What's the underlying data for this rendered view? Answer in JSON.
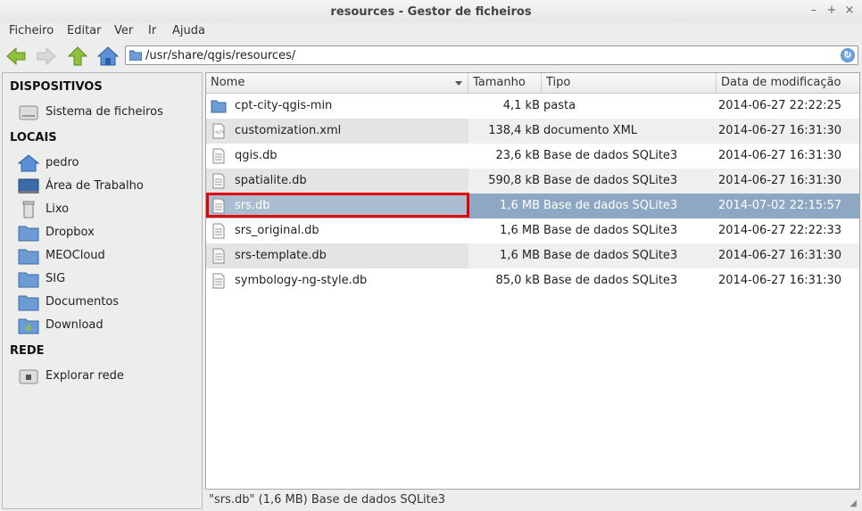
{
  "window": {
    "title": "resources - Gestor de ficheiros"
  },
  "menu": [
    "Ficheiro",
    "Editar",
    "Ver",
    "Ir",
    "Ajuda"
  ],
  "address": {
    "path": "/usr/share/qgis/resources/"
  },
  "sidebar": {
    "sections": [
      {
        "title": "DISPOSITIVOS",
        "items": [
          {
            "label": "Sistema de ficheiros",
            "icon": "drive-icon"
          }
        ]
      },
      {
        "title": "LOCAIS",
        "items": [
          {
            "label": "pedro",
            "icon": "home-icon"
          },
          {
            "label": "Área de Trabalho",
            "icon": "desktop-icon"
          },
          {
            "label": "Lixo",
            "icon": "trash-icon"
          },
          {
            "label": "Dropbox",
            "icon": "folder-icon"
          },
          {
            "label": "MEOCloud",
            "icon": "folder-icon"
          },
          {
            "label": "SIG",
            "icon": "folder-icon"
          },
          {
            "label": "Documentos",
            "icon": "folder-icon"
          },
          {
            "label": "Download",
            "icon": "download-folder-icon"
          }
        ]
      },
      {
        "title": "REDE",
        "items": [
          {
            "label": "Explorar rede",
            "icon": "network-icon"
          }
        ]
      }
    ]
  },
  "columns": {
    "name": "Nome",
    "size": "Tamanho",
    "type": "Tipo",
    "date": "Data de modificação"
  },
  "files": [
    {
      "name": "cpt-city-qgis-min",
      "size": "4,1 kB",
      "type": "pasta",
      "date": "2014-06-27 22:22:25",
      "icon": "folder-icon"
    },
    {
      "name": "customization.xml",
      "size": "138,4 kB",
      "type": "documento XML",
      "date": "2014-06-27 16:31:30",
      "icon": "xml-file-icon"
    },
    {
      "name": "qgis.db",
      "size": "23,6 kB",
      "type": "Base de dados SQLite3",
      "date": "2014-06-27 16:31:30",
      "icon": "document-icon"
    },
    {
      "name": "spatialite.db",
      "size": "590,8 kB",
      "type": "Base de dados SQLite3",
      "date": "2014-06-27 16:31:30",
      "icon": "document-icon"
    },
    {
      "name": "srs.db",
      "size": "1,6 MB",
      "type": "Base de dados SQLite3",
      "date": "2014-07-02 22:15:57",
      "icon": "document-icon",
      "selected": true
    },
    {
      "name": "srs_original.db",
      "size": "1,6 MB",
      "type": "Base de dados SQLite3",
      "date": "2014-06-27 22:22:33",
      "icon": "document-icon"
    },
    {
      "name": "srs-template.db",
      "size": "1,6 MB",
      "type": "Base de dados SQLite3",
      "date": "2014-06-27 16:31:30",
      "icon": "document-icon"
    },
    {
      "name": "symbology-ng-style.db",
      "size": "85,0 kB",
      "type": "Base de dados SQLite3",
      "date": "2014-06-27 16:31:30",
      "icon": "document-icon"
    }
  ],
  "status": {
    "text": "\"srs.db\" (1,6 MB) Base de dados SQLite3"
  },
  "colors": {
    "selection": "#8ea8c3",
    "highlight_box": "#e30000"
  }
}
